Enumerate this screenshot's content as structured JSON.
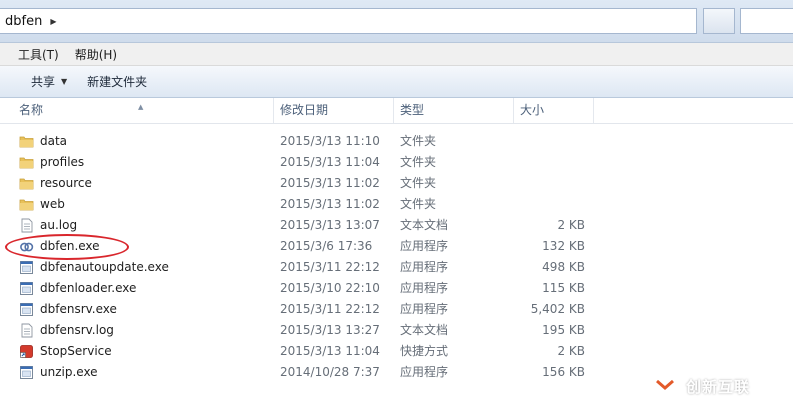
{
  "address": {
    "path": "dbfen"
  },
  "menu": {
    "tools": "工具(T)",
    "help": "帮助(H)"
  },
  "toolbar": {
    "share": "共享",
    "new_folder": "新建文件夹"
  },
  "columns": {
    "name": "名称",
    "date": "修改日期",
    "type": "类型",
    "size": "大小"
  },
  "files": [
    {
      "name": "data",
      "date": "2015/3/13 11:10",
      "type": "文件夹",
      "size": "",
      "icon": "folder-icon"
    },
    {
      "name": "profiles",
      "date": "2015/3/13 11:04",
      "type": "文件夹",
      "size": "",
      "icon": "folder-icon"
    },
    {
      "name": "resource",
      "date": "2015/3/13 11:02",
      "type": "文件夹",
      "size": "",
      "icon": "folder-icon"
    },
    {
      "name": "web",
      "date": "2015/3/13 11:02",
      "type": "文件夹",
      "size": "",
      "icon": "folder-icon"
    },
    {
      "name": "au.log",
      "date": "2015/3/13 13:07",
      "type": "文本文档",
      "size": "2 KB",
      "icon": "text-file-icon"
    },
    {
      "name": "dbfen.exe",
      "date": "2015/3/6 17:36",
      "type": "应用程序",
      "size": "132 KB",
      "icon": "dbfen-app-icon"
    },
    {
      "name": "dbfenautoupdate.exe",
      "date": "2015/3/11 22:12",
      "type": "应用程序",
      "size": "498 KB",
      "icon": "exe-icon"
    },
    {
      "name": "dbfenloader.exe",
      "date": "2015/3/10 22:10",
      "type": "应用程序",
      "size": "115 KB",
      "icon": "exe-icon"
    },
    {
      "name": "dbfensrv.exe",
      "date": "2015/3/11 22:12",
      "type": "应用程序",
      "size": "5,402 KB",
      "icon": "exe-icon"
    },
    {
      "name": "dbfensrv.log",
      "date": "2015/3/13 13:27",
      "type": "文本文档",
      "size": "195 KB",
      "icon": "text-file-icon"
    },
    {
      "name": "StopService",
      "date": "2015/3/13 11:04",
      "type": "快捷方式",
      "size": "2 KB",
      "icon": "shortcut-icon"
    },
    {
      "name": "unzip.exe",
      "date": "2014/10/28 7:37",
      "type": "应用程序",
      "size": "156 KB",
      "icon": "exe-icon"
    }
  ],
  "watermark": {
    "text": "创新互联"
  },
  "colors": {
    "highlight": "#d9262c",
    "folder": "#e8c15a",
    "header_text": "#4c607a"
  }
}
